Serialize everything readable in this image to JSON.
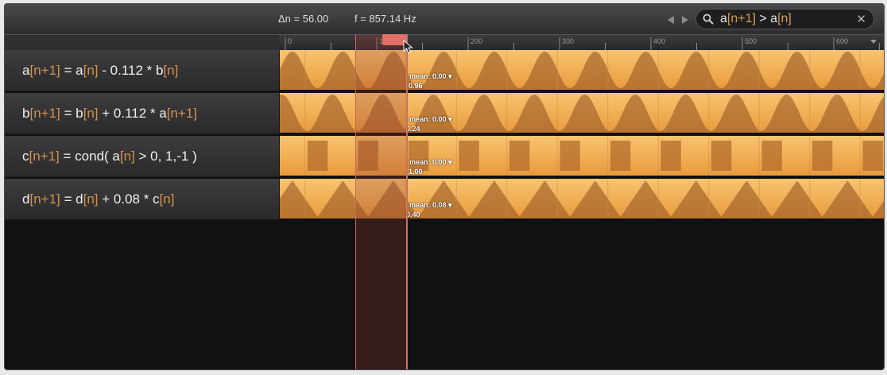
{
  "toolbar": {
    "delta_n": "Δn = 56.00",
    "frequency": "f = 857.14 Hz",
    "search": {
      "prefix": "a",
      "i1": "[n+1]",
      "op": " > a",
      "i2": "[n]"
    },
    "icons": [
      "nav-left-icon",
      "nav-right-icon",
      "search-icon",
      "clear-icon"
    ]
  },
  "ruler": {
    "ticks": [
      "0",
      "100",
      "200",
      "300",
      "400",
      "500",
      "600"
    ]
  },
  "rows": [
    {
      "id": "a",
      "label": [
        "a",
        "[n+1]",
        " = a",
        "[n]",
        " - 0.112 * b",
        "[n]"
      ],
      "mean": "mean: 0.00 ▾",
      "value": "-0.96",
      "wave": "sine",
      "phase": 0
    },
    {
      "id": "b",
      "label": [
        "b",
        "[n+1]",
        " = b",
        "[n]",
        " + 0.112 * a",
        "[n+1]"
      ],
      "mean": "mean: 0.00 ▾",
      "value": "0.24",
      "wave": "sine",
      "phase": 1.3
    },
    {
      "id": "c",
      "label": [
        "c",
        "[n+1]",
        " = cond( a",
        "[n]",
        " > 0, 1,-1 )",
        ""
      ],
      "mean": "mean: 0.00 ▾",
      "value": "-1.00",
      "wave": "square",
      "phase": 0
    },
    {
      "id": "d",
      "label": [
        "d",
        "[n+1]",
        " = d",
        "[n]",
        " + 0.08 * c",
        "[n]"
      ],
      "mean": "mean: 0.08 ▾",
      "value": "0.40",
      "wave": "triangle",
      "phase": 0
    }
  ],
  "colors": {
    "wave_light": "#f5b455",
    "wave_dark": "#a0602a",
    "accent": "#d4924a",
    "selection": "#e07068"
  }
}
